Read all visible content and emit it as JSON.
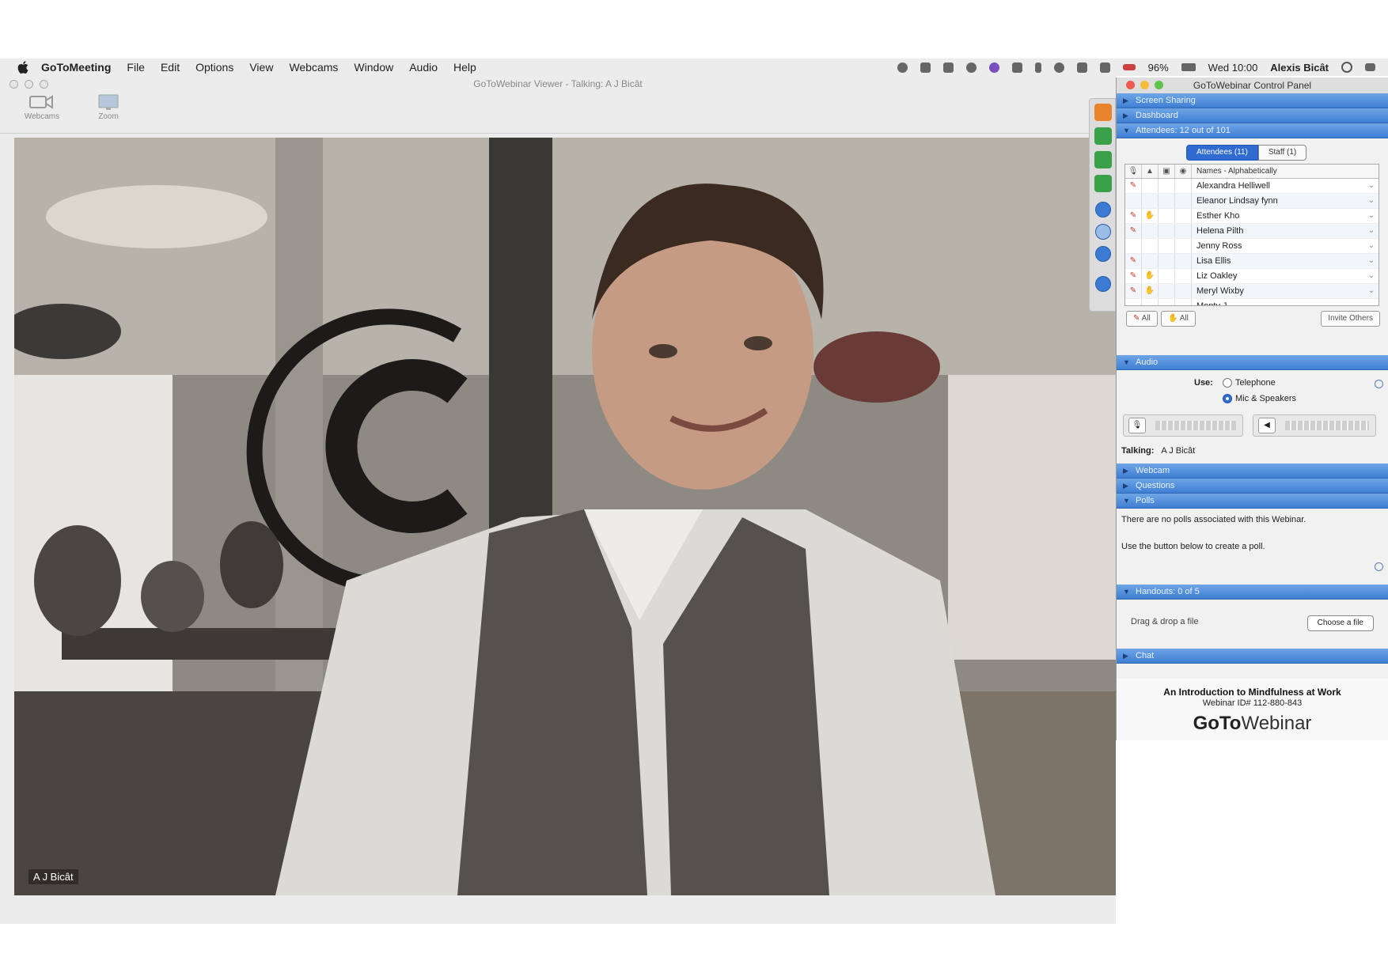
{
  "menubar": {
    "app_name": "GoToMeeting",
    "menus": [
      "File",
      "Edit",
      "Options",
      "View",
      "Webcams",
      "Window",
      "Audio",
      "Help"
    ],
    "battery": "96%",
    "clock": "Wed 10:00",
    "user": "Alexis Bicât"
  },
  "viewer": {
    "title": "GoToWebinar Viewer - Talking: A J Bicât",
    "toolbar": {
      "webcams_label": "Webcams",
      "zoom_label": "Zoom"
    },
    "video_name_tag": "A J Bicât"
  },
  "control_panel": {
    "title": "GoToWebinar Control Panel",
    "sections": {
      "screen_sharing": "Screen Sharing",
      "dashboard": "Dashboard",
      "attendees": "Attendees: 12 out of 101",
      "audio": "Audio",
      "webcam": "Webcam",
      "questions": "Questions",
      "polls": "Polls",
      "handouts": "Handouts: 0 of 5",
      "chat": "Chat"
    },
    "attendee_tabs": {
      "attendees": "Attendees (11)",
      "staff": "Staff (1)"
    },
    "attendee_sort": "Names - Alphabetically",
    "attendees": [
      {
        "name": "Alexandra Helliwell",
        "pencil": true,
        "hand": false
      },
      {
        "name": "Eleanor Lindsay fynn",
        "pencil": false,
        "hand": false
      },
      {
        "name": "Esther Kho",
        "pencil": true,
        "hand": true
      },
      {
        "name": "Helena Pilth",
        "pencil": true,
        "hand": false
      },
      {
        "name": "Jenny Ross",
        "pencil": false,
        "hand": false
      },
      {
        "name": "Lisa Ellis",
        "pencil": true,
        "hand": false
      },
      {
        "name": "Liz Oakley",
        "pencil": true,
        "hand": true
      },
      {
        "name": "Meryl Wixby",
        "pencil": true,
        "hand": true
      },
      {
        "name": "Monty J",
        "pencil": false,
        "hand": false
      }
    ],
    "attendee_buttons": {
      "draw_all": "All",
      "hand_all": "All",
      "invite": "Invite Others"
    },
    "audio": {
      "use_label": "Use:",
      "telephone": "Telephone",
      "mic_speakers": "Mic & Speakers",
      "selected": "mic_speakers",
      "talking_label": "Talking:",
      "talking_name": "A J Bicât"
    },
    "polls": {
      "line1": "There are no polls associated with this Webinar.",
      "line2": "Use the button below to create a poll."
    },
    "handouts": {
      "drop_text": "Drag & drop a file",
      "choose_button": "Choose a file"
    },
    "footer": {
      "webinar_title": "An Introduction to Mindfulness at Work",
      "webinar_id": "Webinar ID# 112-880-843",
      "logo_bold": "GoTo",
      "logo_regular": "Webinar"
    }
  },
  "colors": {
    "section_blue": "#3f7ed3",
    "tab_active": "#2f6bd0"
  }
}
